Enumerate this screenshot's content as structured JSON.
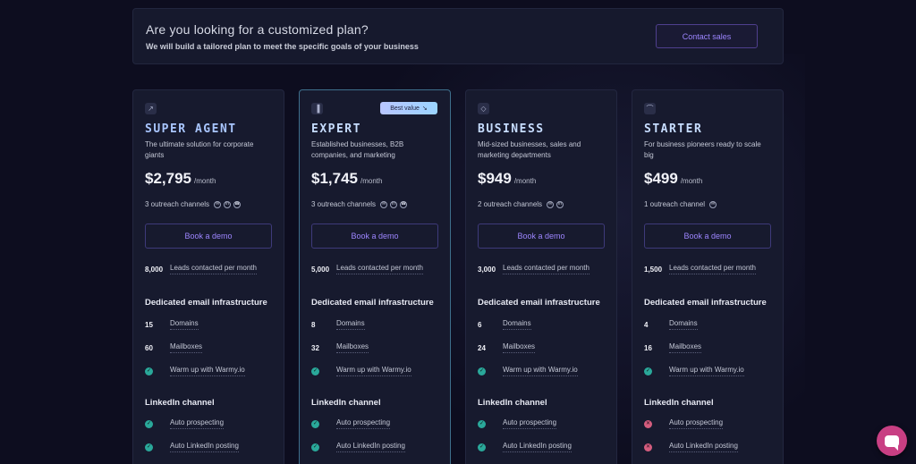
{
  "banner": {
    "title": "Are you looking for a customized plan?",
    "subtitle": "We will build a tailored plan to meet the specific goals of your business",
    "contact_label": "Contact sales"
  },
  "labels": {
    "book_demo": "Book a demo",
    "leads_suffix": "Leads contacted per month",
    "dedicated_email": "Dedicated email infrastructure",
    "domains": "Domains",
    "mailboxes": "Mailboxes",
    "warmup": "Warm up with Warmy.io",
    "linkedin": "LinkedIn channel",
    "auto_prospecting": "Auto prospecting",
    "auto_posting": "Auto LinkedIn posting",
    "per_month": "/month"
  },
  "plans": [
    {
      "icon": "rocket-icon",
      "name": "SUPER AGENT",
      "desc": "The ultimate solution for corporate giants",
      "price": "$2,795",
      "outreach": "3 outreach channels",
      "channels": [
        "email-icon",
        "linkedin-icon",
        "phone-icon"
      ],
      "leads": "8,000",
      "domains": "15",
      "mailboxes": "60",
      "auto_prospecting": true,
      "auto_posting": true
    },
    {
      "icon": "bar-chart-icon",
      "name": "EXPERT",
      "badge": "Best value",
      "desc": "Established businesses, B2B companies, and marketing",
      "price": "$1,745",
      "outreach": "3 outreach channels",
      "channels": [
        "email-icon",
        "linkedin-icon",
        "phone-icon"
      ],
      "leads": "5,000",
      "domains": "8",
      "mailboxes": "32",
      "auto_prospecting": true,
      "auto_posting": true
    },
    {
      "icon": "tag-icon",
      "name": "BUSINESS",
      "desc": "Mid-sized businesses, sales and marketing departments",
      "price": "$949",
      "outreach": "2 outreach channels",
      "channels": [
        "email-icon",
        "linkedin-icon"
      ],
      "leads": "3,000",
      "domains": "6",
      "mailboxes": "24",
      "auto_prospecting": true,
      "auto_posting": true
    },
    {
      "icon": "wifi-icon",
      "name": "STARTER",
      "desc": "For business pioneers ready to scale big",
      "price": "$499",
      "outreach": "1 outreach channel",
      "channels": [
        "email-icon"
      ],
      "leads": "1,500",
      "domains": "4",
      "mailboxes": "16",
      "auto_prospecting": false,
      "auto_posting": false
    }
  ],
  "colors": {
    "background": "#0d0d1f",
    "card": "#171a2e",
    "accent": "#9d86ff",
    "check": "#2aa89a",
    "cross": "#d45d7e",
    "chat": "#c83f83"
  }
}
